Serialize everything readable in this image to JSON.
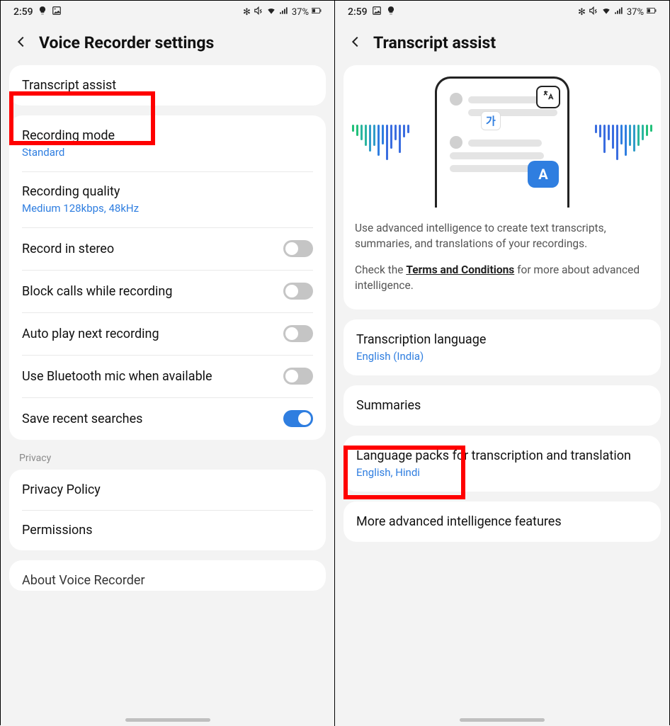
{
  "statusbar": {
    "time": "2:59",
    "battery": "37%"
  },
  "left": {
    "title": "Voice Recorder settings",
    "transcript_label": "Transcript assist",
    "recording_mode": {
      "title": "Recording mode",
      "value": "Standard"
    },
    "recording_quality": {
      "title": "Recording quality",
      "value": "Medium 128kbps, 48kHz"
    },
    "toggles": {
      "stereo": "Record in stereo",
      "block_calls": "Block calls while recording",
      "autoplay": "Auto play next recording",
      "bluetooth": "Use Bluetooth mic when available",
      "recent_searches": "Save recent searches"
    },
    "privacy_label": "Privacy",
    "privacy_policy": "Privacy Policy",
    "permissions": "Permissions",
    "about": "About Voice Recorder"
  },
  "right": {
    "title": "Transcript assist",
    "desc1": "Use advanced intelligence to create text transcripts, summaries, and translations of your recordings.",
    "desc2a": "Check the ",
    "desc2_link": "Terms and Conditions",
    "desc2b": " for more about advanced intelligence.",
    "lang": {
      "title": "Transcription language",
      "value": "English (India)"
    },
    "summaries": "Summaries",
    "packs": {
      "title": "Language packs for transcription and translation",
      "value": "English, Hindi"
    },
    "more": "More advanced intelligence features",
    "illus": {
      "ko": "가",
      "a": "A"
    }
  }
}
